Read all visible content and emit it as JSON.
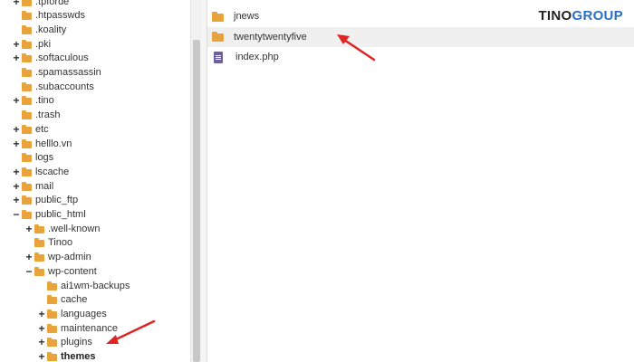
{
  "tree": {
    "items": [
      {
        "label": ".tpforde",
        "toggle": "+",
        "indent": 0
      },
      {
        "label": ".htpasswds",
        "toggle": "",
        "indent": 0
      },
      {
        "label": ".koality",
        "toggle": "",
        "indent": 0
      },
      {
        "label": ".pki",
        "toggle": "+",
        "indent": 0
      },
      {
        "label": ".softaculous",
        "toggle": "+",
        "indent": 0
      },
      {
        "label": ".spamassassin",
        "toggle": "",
        "indent": 0
      },
      {
        "label": ".subaccounts",
        "toggle": "",
        "indent": 0
      },
      {
        "label": ".tino",
        "toggle": "+",
        "indent": 0
      },
      {
        "label": ".trash",
        "toggle": "",
        "indent": 0
      },
      {
        "label": "etc",
        "toggle": "+",
        "indent": 0
      },
      {
        "label": "helllo.vn",
        "toggle": "+",
        "indent": 0
      },
      {
        "label": "logs",
        "toggle": "",
        "indent": 0
      },
      {
        "label": "lscache",
        "toggle": "+",
        "indent": 0
      },
      {
        "label": "mail",
        "toggle": "+",
        "indent": 0
      },
      {
        "label": "public_ftp",
        "toggle": "+",
        "indent": 0
      },
      {
        "label": "public_html",
        "toggle": "−",
        "indent": 0
      },
      {
        "label": ".well-known",
        "toggle": "+",
        "indent": 1
      },
      {
        "label": "Tinoo",
        "toggle": "",
        "indent": 1
      },
      {
        "label": "wp-admin",
        "toggle": "+",
        "indent": 1
      },
      {
        "label": "wp-content",
        "toggle": "−",
        "indent": 1
      },
      {
        "label": "ai1wm-backups",
        "toggle": "",
        "indent": 2
      },
      {
        "label": "cache",
        "toggle": "",
        "indent": 2
      },
      {
        "label": "languages",
        "toggle": "+",
        "indent": 2
      },
      {
        "label": "maintenance",
        "toggle": "+",
        "indent": 2
      },
      {
        "label": "plugins",
        "toggle": "+",
        "indent": 2
      },
      {
        "label": "themes",
        "toggle": "+",
        "indent": 2,
        "bold": true
      }
    ]
  },
  "files": [
    {
      "name": "jnews",
      "type": "folder"
    },
    {
      "name": "twentytwentyfive",
      "type": "folder",
      "selected": true
    },
    {
      "name": "index.php",
      "type": "file"
    }
  ],
  "logo": {
    "part1": "TINO",
    "part2": "GROUP"
  },
  "colors": {
    "folder": "#e8a33c",
    "arrow": "#e02424",
    "file_icon": "#6a5fa8"
  }
}
